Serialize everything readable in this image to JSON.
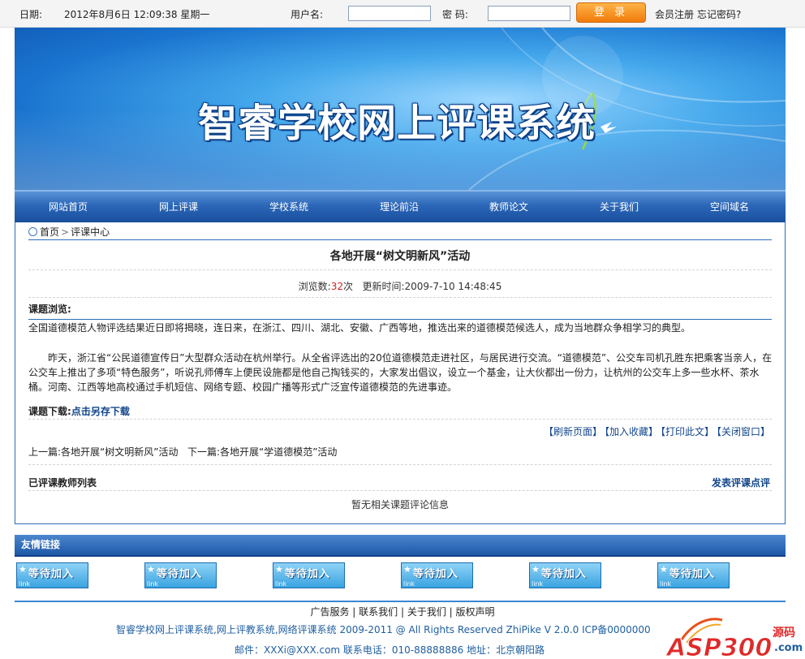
{
  "topbar": {
    "date_label": "日期:",
    "datetime": "2012年8月6日 12:09:38 星期一",
    "username_label": "用户名:",
    "password_label": "密 码:",
    "login_label": "登 录",
    "register_link": "会员注册",
    "forgot_link": "忘记密码?"
  },
  "banner": {
    "title": "智睿学校网上评课系统"
  },
  "nav": {
    "items": [
      "网站首页",
      "网上评课",
      "学校系统",
      "理论前沿",
      "教师论文",
      "关于我们",
      "空间域名"
    ]
  },
  "breadcrumb": {
    "home": "首页",
    "separator": ">",
    "current": "评课中心"
  },
  "article": {
    "title": "各地开展“树文明新风”活动",
    "views_label": "浏览数:",
    "views_count": "32",
    "views_unit": "次",
    "updated_label": "更新时间:",
    "updated_time": "2009-7-10 14:48:45",
    "browse_label": "课题浏览:",
    "para1": "全国道德模范人物评选结果近日即将揭晓，连日来，在浙江、四川、湖北、安徽、广西等地，推选出来的道德模范候选人，成为当地群众争相学习的典型。",
    "para2": "昨天，浙江省“公民道德宣传日”大型群众活动在杭州举行。从全省评选出的20位道德模范走进社区，与居民进行交流。“道德模范”、公交车司机孔胜东把乘客当亲人，在公交车上推出了多项“特色服务”，听说孔师傅车上便民设施都是他自己掏钱买的，大家发出倡议，设立一个基金，让大伙都出一份力，让杭州的公交车上多一些水杯、茶水桶。河南、江西等地高校通过手机短信、网络专题、校园广播等形式广泛宣传道德模范的先进事迹。",
    "download_label": "课题下载:",
    "download_link": "点击另存下载",
    "actions": [
      "【刷新页面】",
      "【加入收藏】",
      "【打印此文】",
      "【关闭窗口】"
    ],
    "prev_label": "上一篇:",
    "prev_title": "各地开展“树文明新风”活动",
    "next_label": "下一篇:",
    "next_title": "各地开展“学道德模范”活动",
    "reviewers_label": "已评课教师列表",
    "post_review": "发表评课点评",
    "no_review": "暂无相关课题评论信息"
  },
  "friend_links": {
    "heading": "友情链接",
    "badge_text": "等待加入",
    "badge_sub": "link",
    "count": 6
  },
  "footer": {
    "links": [
      "广告服务",
      "联系我们",
      "关于我们",
      "版权声明"
    ],
    "copyright": "智睿学校网上评课系统,网上评教系统,网络评课系统  2009-2011 @ All Rights Reserved ZhiPike V 2.0.0  ICP备0000000",
    "contact": "邮件：XXXi@XXX.com  联系电话：010-88888886    地址：北京朝阳路",
    "logo_text": "ASP300",
    "logo_sub_top": "源码",
    "logo_sub_bottom": ".com"
  },
  "colors": {
    "nav_blue": "#2b67b8",
    "link_blue": "#13468c",
    "login_orange": "#f07b0a",
    "count_red": "#d42020"
  }
}
